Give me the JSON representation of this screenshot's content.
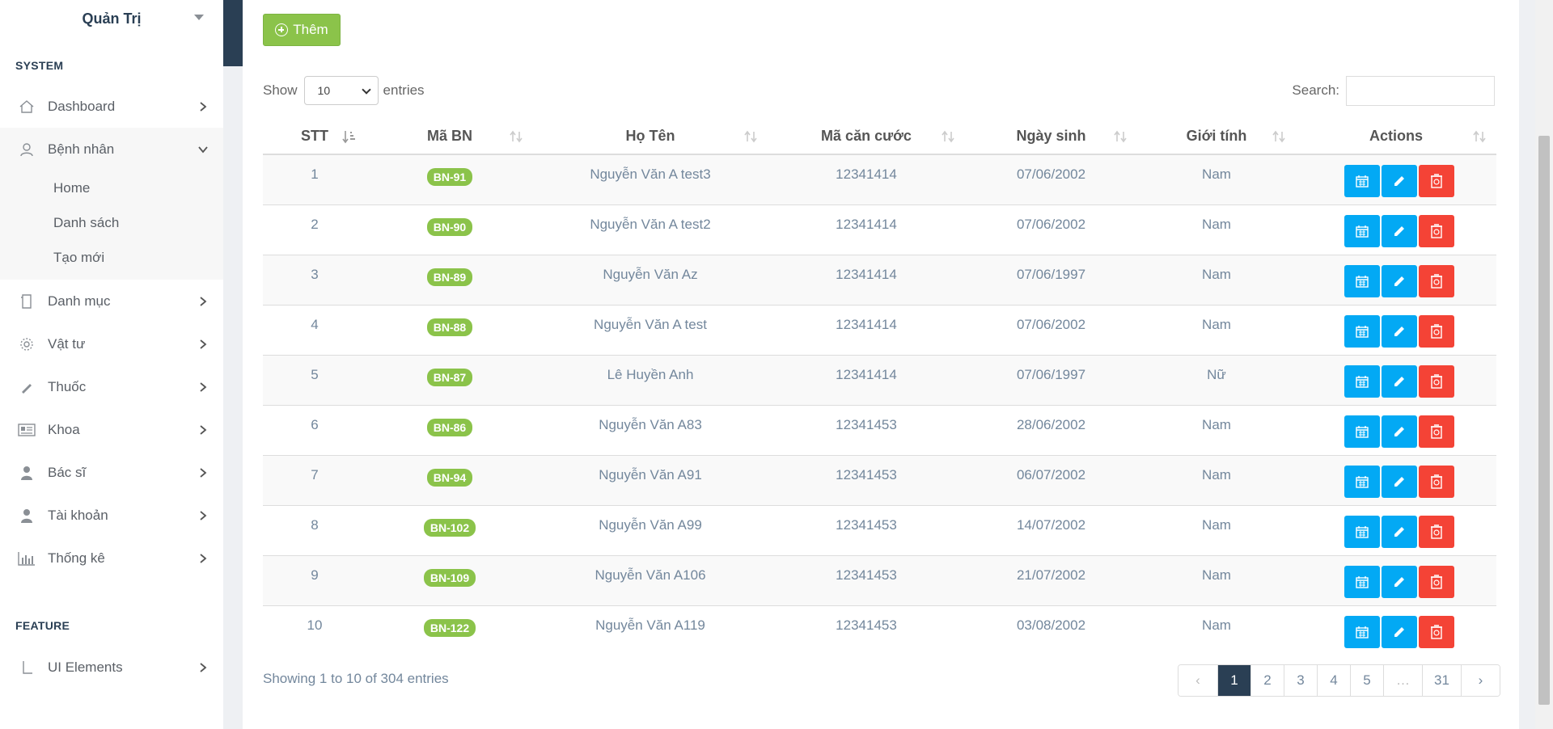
{
  "sidebar": {
    "user_name": "Quản Trị",
    "section_system": "SYSTEM",
    "section_feature": "FEATURE",
    "items": [
      {
        "label": "Dashboard",
        "icon": "home-icon"
      },
      {
        "label": "Bệnh nhân",
        "icon": "user-icon",
        "expanded": true
      },
      {
        "label": "Danh mục",
        "icon": "file-icon"
      },
      {
        "label": "Vật tư",
        "icon": "gear-icon"
      },
      {
        "label": "Thuốc",
        "icon": "pen-icon"
      },
      {
        "label": "Khoa",
        "icon": "card-icon"
      },
      {
        "label": "Bác sĩ",
        "icon": "doctor-icon"
      },
      {
        "label": "Tài khoản",
        "icon": "person-icon"
      },
      {
        "label": "Thống kê",
        "icon": "chart-icon"
      }
    ],
    "subitems": [
      {
        "label": "Home"
      },
      {
        "label": "Danh sách"
      },
      {
        "label": "Tạo mới"
      }
    ],
    "feature_items": [
      {
        "label": "UI Elements",
        "icon": "bug-icon"
      }
    ]
  },
  "toolbar": {
    "add_label": "Thêm",
    "show_label": "Show",
    "entries_label": "entries",
    "page_length": "10",
    "search_label": "Search:",
    "search_value": ""
  },
  "table": {
    "columns": [
      "STT",
      "Mã BN",
      "Họ Tên",
      "Mã căn cước",
      "Ngày sinh",
      "Giới tính",
      "Actions"
    ],
    "rows": [
      {
        "stt": "1",
        "code": "BN-91",
        "name": "Nguyễn Văn A test3",
        "id": "12341414",
        "dob": "07/06/2002",
        "gender": "Nam"
      },
      {
        "stt": "2",
        "code": "BN-90",
        "name": "Nguyễn Văn A test2",
        "id": "12341414",
        "dob": "07/06/2002",
        "gender": "Nam"
      },
      {
        "stt": "3",
        "code": "BN-89",
        "name": "Nguyễn Văn Az",
        "id": "12341414",
        "dob": "07/06/1997",
        "gender": "Nam"
      },
      {
        "stt": "4",
        "code": "BN-88",
        "name": "Nguyễn Văn A test",
        "id": "12341414",
        "dob": "07/06/2002",
        "gender": "Nam"
      },
      {
        "stt": "5",
        "code": "BN-87",
        "name": "Lê Huyền Anh",
        "id": "12341414",
        "dob": "07/06/1997",
        "gender": "Nữ"
      },
      {
        "stt": "6",
        "code": "BN-86",
        "name": "Nguyễn Văn A83",
        "id": "12341453",
        "dob": "28/06/2002",
        "gender": "Nam"
      },
      {
        "stt": "7",
        "code": "BN-94",
        "name": "Nguyễn Văn A91",
        "id": "12341453",
        "dob": "06/07/2002",
        "gender": "Nam"
      },
      {
        "stt": "8",
        "code": "BN-102",
        "name": "Nguyễn Văn A99",
        "id": "12341453",
        "dob": "14/07/2002",
        "gender": "Nam"
      },
      {
        "stt": "9",
        "code": "BN-109",
        "name": "Nguyễn Văn A106",
        "id": "12341453",
        "dob": "21/07/2002",
        "gender": "Nam"
      },
      {
        "stt": "10",
        "code": "BN-122",
        "name": "Nguyễn Văn A119",
        "id": "12341453",
        "dob": "03/08/2002",
        "gender": "Nam"
      }
    ]
  },
  "footer": {
    "info": "Showing 1 to 10 of 304 entries",
    "pages": [
      {
        "label": "‹",
        "state": "disabled"
      },
      {
        "label": "1",
        "state": "active"
      },
      {
        "label": "2",
        "state": ""
      },
      {
        "label": "3",
        "state": ""
      },
      {
        "label": "4",
        "state": ""
      },
      {
        "label": "5",
        "state": ""
      },
      {
        "label": "…",
        "state": "disabled"
      },
      {
        "label": "31",
        "state": ""
      },
      {
        "label": "›",
        "state": ""
      }
    ]
  },
  "colors": {
    "navy": "#2a3f54",
    "green": "#8bc34a",
    "blue": "#03a9f4",
    "red": "#f44336"
  }
}
